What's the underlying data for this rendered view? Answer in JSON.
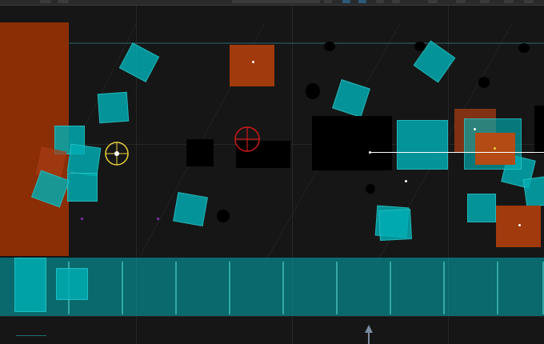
{
  "scene": {
    "background_color": "#161616",
    "accent_colors": {
      "cyan": "#00afb4",
      "orange": "#8b2e06",
      "player_crosshair": "#e8d23a",
      "target_crosshair": "#d01818",
      "laser": "#ffffff"
    },
    "icons": {
      "player": "yellow-crosshair-icon",
      "target": "red-crosshair-icon",
      "spawn_marker": "up-arrow-icon"
    }
  },
  "toolbar": {
    "icons": [
      "toolbar-button",
      "toolbar-button-active"
    ]
  }
}
